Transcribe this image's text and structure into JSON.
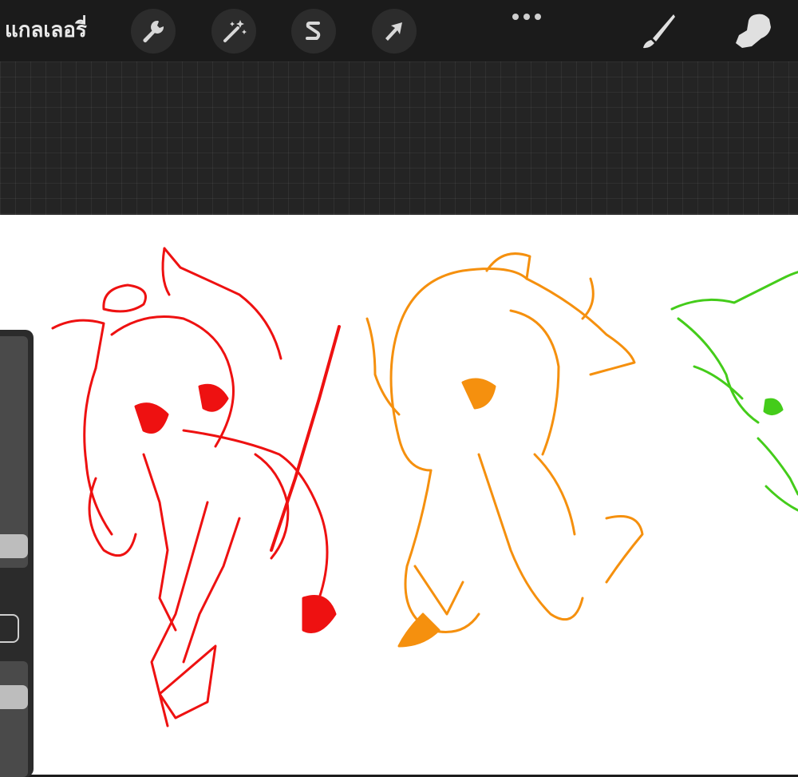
{
  "toolbar": {
    "gallery_label": "แกลเลอรี่",
    "left_tools": [
      {
        "name": "actions",
        "icon": "wrench-icon"
      },
      {
        "name": "adjustments",
        "icon": "magic-wand-icon"
      },
      {
        "name": "selection",
        "icon": "selection-s-icon"
      },
      {
        "name": "transform",
        "icon": "arrow-cursor-icon"
      }
    ],
    "more_icon": "ellipsis-icon",
    "right_tools": [
      {
        "name": "paint",
        "icon": "brush-icon"
      },
      {
        "name": "smudge",
        "icon": "smudge-finger-icon"
      }
    ]
  },
  "sidebar": {
    "brush_size_slider": {
      "level": 0.45
    },
    "opacity_slider": {
      "level": 0.85
    },
    "modify_button_icon": "square-outline-icon"
  },
  "canvas": {
    "sketches": [
      {
        "name": "red-cat-sketch",
        "color": "#ee1111"
      },
      {
        "name": "orange-cat-sketch",
        "color": "#f5900e"
      },
      {
        "name": "green-cat-sketch",
        "color": "#44cc1a"
      }
    ]
  }
}
